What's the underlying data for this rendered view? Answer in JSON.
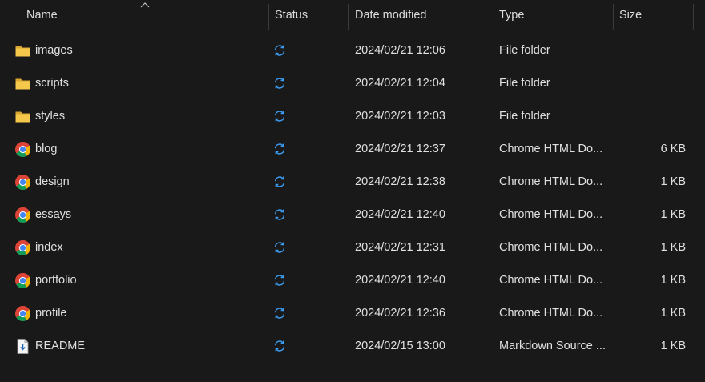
{
  "columns": {
    "name": "Name",
    "status": "Status",
    "date_modified": "Date modified",
    "type": "Type",
    "size": "Size"
  },
  "sort": {
    "column": "Name",
    "direction": "ascending"
  },
  "colors": {
    "background": "#191919",
    "folder": "#f0c24e",
    "sync_blue": "#3b9cf0"
  },
  "files": [
    {
      "icon": "folder-icon",
      "name": "images",
      "status": "sync-icon",
      "date": "2024/02/21 12:06",
      "type": "File folder",
      "size": ""
    },
    {
      "icon": "folder-icon",
      "name": "scripts",
      "status": "sync-icon",
      "date": "2024/02/21 12:04",
      "type": "File folder",
      "size": ""
    },
    {
      "icon": "folder-icon",
      "name": "styles",
      "status": "sync-icon",
      "date": "2024/02/21 12:03",
      "type": "File folder",
      "size": ""
    },
    {
      "icon": "chrome-icon",
      "name": "blog",
      "status": "sync-icon",
      "date": "2024/02/21 12:37",
      "type": "Chrome HTML Do...",
      "size": "6 KB"
    },
    {
      "icon": "chrome-icon",
      "name": "design",
      "status": "sync-icon",
      "date": "2024/02/21 12:38",
      "type": "Chrome HTML Do...",
      "size": "1 KB"
    },
    {
      "icon": "chrome-icon",
      "name": "essays",
      "status": "sync-icon",
      "date": "2024/02/21 12:40",
      "type": "Chrome HTML Do...",
      "size": "1 KB"
    },
    {
      "icon": "chrome-icon",
      "name": "index",
      "status": "sync-icon",
      "date": "2024/02/21 12:31",
      "type": "Chrome HTML Do...",
      "size": "1 KB"
    },
    {
      "icon": "chrome-icon",
      "name": "portfolio",
      "status": "sync-icon",
      "date": "2024/02/21 12:40",
      "type": "Chrome HTML Do...",
      "size": "1 KB"
    },
    {
      "icon": "chrome-icon",
      "name": "profile",
      "status": "sync-icon",
      "date": "2024/02/21 12:36",
      "type": "Chrome HTML Do...",
      "size": "1 KB"
    },
    {
      "icon": "markdown-file-icon",
      "name": "README",
      "status": "sync-icon",
      "date": "2024/02/15 13:00",
      "type": "Markdown Source ...",
      "size": "1 KB"
    }
  ]
}
